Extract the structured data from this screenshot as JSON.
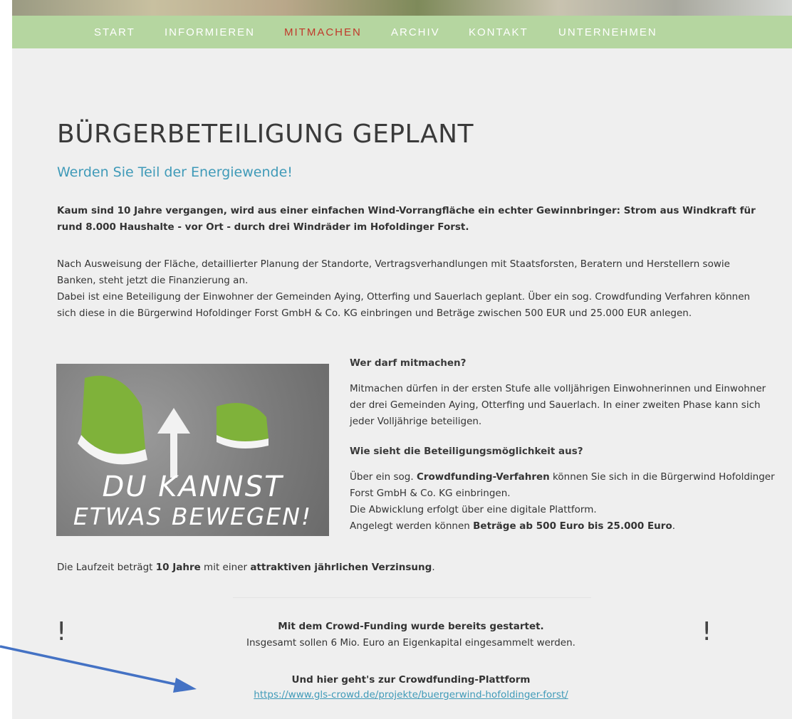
{
  "nav": [
    "START",
    "INFORMIEREN",
    "MITMACHEN",
    "ARCHIV",
    "KONTAKT",
    "UNTERNEHMEN"
  ],
  "title": "BÜRGERBETEILIGUNG GEPLANT",
  "subtitle": "Werden Sie Teil der Energiewende!",
  "intro": "Kaum sind 10 Jahre vergangen, wird aus einer einfachen Wind-Vorrangfläche ein echter Gewinnbringer: Strom aus Windkraft für rund 8.000 Haushalte - vor Ort - durch drei Windräder im Hofoldinger Forst.",
  "para1": "Nach Ausweisung der Fläche, detaillierter Planung der Standorte, Vertragsverhandlungen mit Staatsforsten, Beratern und Herstellern sowie Banken, steht jetzt die Finanzierung an.",
  "para2": "Dabei ist eine Beteiligung der Einwohner der Gemeinden Aying, Otterfing und Sauerlach geplant. Über ein sog. Crowdfunding Verfahren können sich diese in die Bürgerwind Hofoldinger Forst GmbH & Co. KG einbringen und Beträge zwischen 500 EUR und 25.000 EUR anlegen.",
  "image_text": {
    "line1": "DU KANNST",
    "line2": "ETWAS BEWEGEN!"
  },
  "who": {
    "heading": "Wer darf mitmachen?",
    "text": "Mitmachen dürfen in der ersten Stufe alle volljährigen Einwohnerinnen und Einwohner der drei Gemeinden Aying, Otterfing und Sauerlach. In einer zweiten Phase kann sich jeder Volljährige beteiligen."
  },
  "how": {
    "heading": "Wie sieht die Beteiligungsmöglichkeit aus?",
    "t1": "Über ein sog. ",
    "t1b": "Crowdfunding-Verfahren",
    "t1c": " können Sie sich in die Bürgerwind Hofoldinger Forst GmbH & Co. KG einbringen.",
    "t2": "Die Abwicklung erfolgt über eine digitale Plattform.",
    "t3": "Angelegt werden können ",
    "t3b": "Beträge ab 500 Euro bis 25.000 Euro",
    "t3c": "."
  },
  "runtime": {
    "t1": "Die Laufzeit beträgt ",
    "t1b": "10 Jahre",
    "t2": " mit einer ",
    "t2b": "attraktiven jährlichen Verzinsung",
    "t3": "."
  },
  "notice": {
    "mark": "!",
    "line1": "Mit dem Crowd-Funding wurde bereits gestartet.",
    "line2": "Insgesamt sollen 6 Mio. Euro an Eigenkapital eingesammelt werden.",
    "platform_label": "Und hier geht's zur Crowdfunding-Plattform",
    "platform_url": "https://www.gls-crowd.de/projekte/buergerwind-hofoldinger-forst/"
  },
  "colors": {
    "nav_bg": "#b5d6a0",
    "nav_active": "#c0392b",
    "accent": "#3f9ab8",
    "arrow": "#4472c4"
  },
  "icons": [
    "annotation-arrow-icon"
  ]
}
